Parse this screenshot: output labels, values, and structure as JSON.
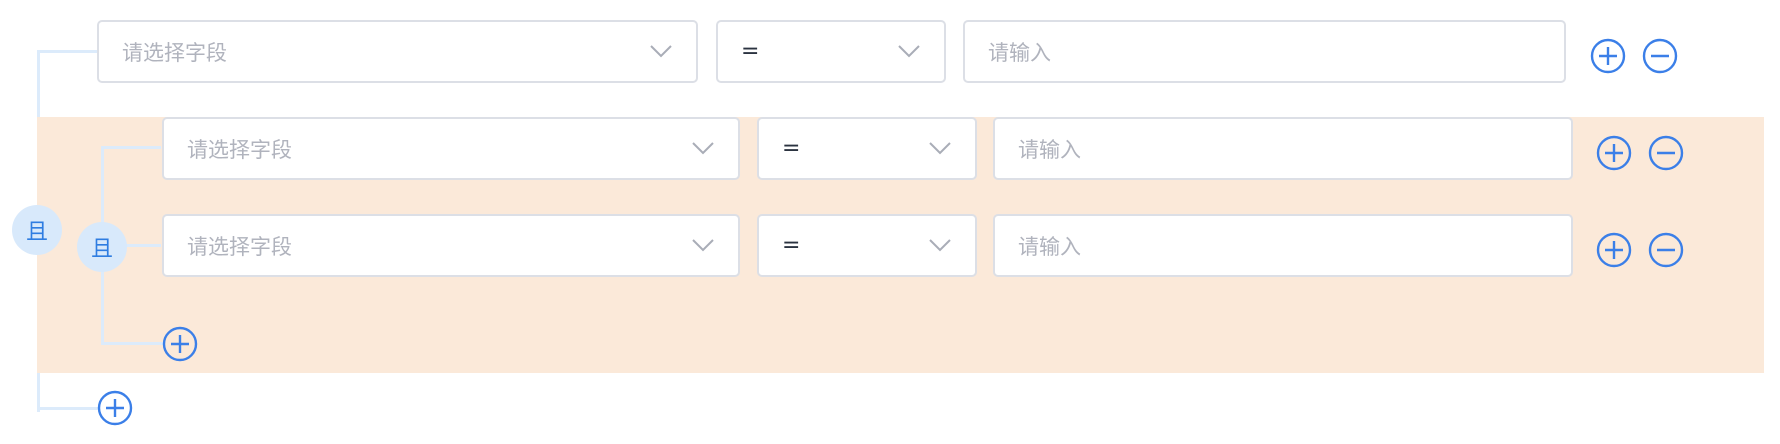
{
  "root_group": {
    "logic_label": "且",
    "rows": [
      {
        "field_placeholder": "请选择字段",
        "operator": "=",
        "value_placeholder": "请输入"
      }
    ],
    "nested_group": {
      "logic_label": "且",
      "rows": [
        {
          "field_placeholder": "请选择字段",
          "operator": "=",
          "value_placeholder": "请输入"
        },
        {
          "field_placeholder": "请选择字段",
          "operator": "=",
          "value_placeholder": "请输入"
        }
      ]
    }
  },
  "icons": {
    "add": "plus-circle-icon",
    "remove": "minus-circle-icon",
    "dropdown": "chevron-down-icon"
  },
  "colors": {
    "accent": "#3b7fe8",
    "connector": "#dcebfb",
    "logic_badge_bg": "#d8e9fb",
    "nested_group_bg": "#fbe9d9",
    "border": "#dcdfe6",
    "placeholder": "#b0b3bd"
  }
}
